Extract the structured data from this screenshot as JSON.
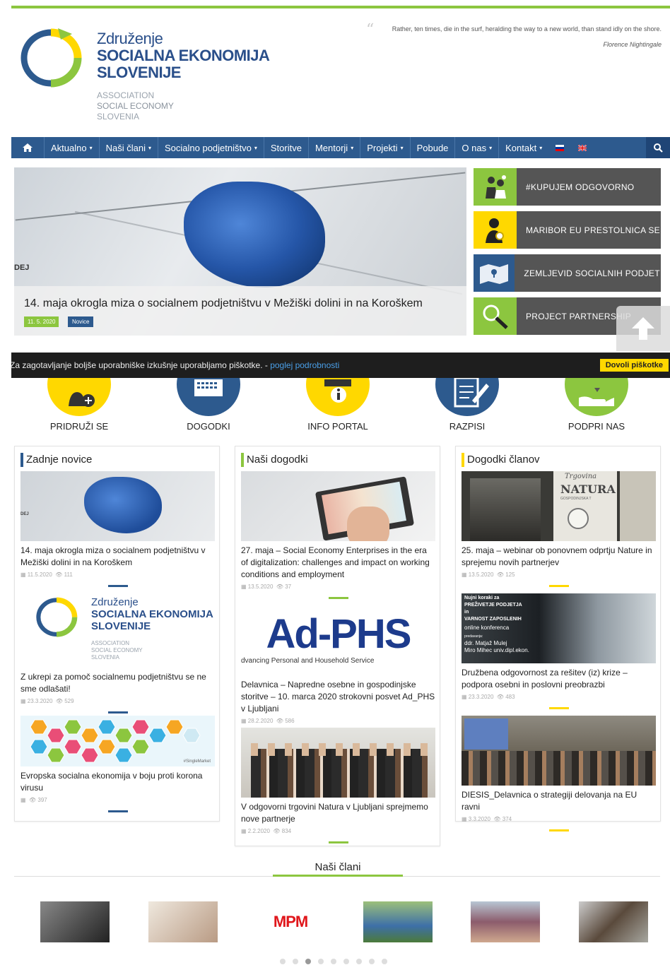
{
  "logo": {
    "line1": "Združenje",
    "line2": "SOCIALNA EKONOMIJA",
    "line3": "SLOVENIJE",
    "sub1": "ASSOCIATION",
    "sub2": "SOCIAL ECONOMY",
    "sub3": "SLOVENIA"
  },
  "quote": {
    "text": "Rather, ten times, die in the surf, heralding the way to a new world, than stand idly on the shore.",
    "author": "Florence Nightingale"
  },
  "nav": {
    "items": [
      {
        "label": "Aktualno",
        "dropdown": true
      },
      {
        "label": "Naši člani",
        "dropdown": true
      },
      {
        "label": "Socialno podjetništvo",
        "dropdown": true
      },
      {
        "label": "Storitve",
        "dropdown": false
      },
      {
        "label": "Mentorji",
        "dropdown": true
      },
      {
        "label": "Projekti",
        "dropdown": true
      },
      {
        "label": "Pobude",
        "dropdown": false
      },
      {
        "label": "O nas",
        "dropdown": true
      },
      {
        "label": "Kontakt",
        "dropdown": true
      }
    ]
  },
  "hero": {
    "image_text": "DEJ",
    "title": "14. maja okrogla miza o socialnem podjetništvu v Mežiški dolini in na Koroškem",
    "date": "11. 5. 2020",
    "category": "Novice"
  },
  "tiles": [
    {
      "label": "#KUPUJEM ODGOVORNO",
      "icon": "people-icon",
      "color": "#8cc63f"
    },
    {
      "label": "MARIBOR EU PRESTOLNICA SE",
      "icon": "award-person-icon",
      "color": "#ffd800"
    },
    {
      "label": "ZEMLJEVID SOCIALNIH PODJETIJ",
      "icon": "map-icon",
      "color": "#2d5a8e"
    },
    {
      "label": "PROJECT PARTNERSHIP",
      "icon": "search-icon",
      "color": "#8cc63f"
    }
  ],
  "cookie": {
    "text": "Za zagotavljanje boljše uporabniške izkušnje uporabljamo piškotke. - ",
    "link": "poglej podrobnosti",
    "button": "Dovoli piškotke"
  },
  "circles": [
    {
      "label": "PRIDRUŽI SE",
      "color": "#ffd800"
    },
    {
      "label": "DOGODKI",
      "color": "#2d5a8e"
    },
    {
      "label": "INFO PORTAL",
      "color": "#ffd800"
    },
    {
      "label": "RAZPISI",
      "color": "#2d5a8e"
    },
    {
      "label": "PODPRI NAS",
      "color": "#8cc63f"
    }
  ],
  "columns": [
    {
      "title": "Zadnje novice",
      "accent": "#2d5a8e",
      "cards": [
        {
          "title": "14. maja okrogla miza o socialnem podjetništvu v Mežiški dolini in na Koroškem",
          "date": "11.5.2020",
          "views": "111"
        },
        {
          "title": "Z ukrepi za pomoč socialnemu podjetništvu se ne sme odlašati!",
          "date": "23.3.2020",
          "views": "529"
        },
        {
          "title": "Evropska socialna ekonomija v boju proti korona virusu",
          "date": "",
          "views": "397"
        }
      ]
    },
    {
      "title": "Naši dogodki",
      "accent": "#8cc63f",
      "cards": [
        {
          "title": "27. maja – Social Economy Enterprises in the era of digitalization: challenges and impact on working conditions and employment",
          "date": "13.5.2020",
          "views": "37"
        },
        {
          "title": "Delavnica – Napredne osebne in gospodinjske storitve – 10. marca 2020 strokovni posvet Ad_PHS v Ljubljani",
          "date": "28.2.2020",
          "views": "586"
        },
        {
          "title": "V odgovorni trgovini Natura v Ljubljani sprejmemo nove partnerje",
          "date": "2.2.2020",
          "views": "834"
        }
      ]
    },
    {
      "title": "Dogodki članov",
      "accent": "#ffd800",
      "cards": [
        {
          "title": "25. maja – webinar ob ponovnem odprtju Nature in sprejemu novih partnerjev",
          "date": "13.5.2020",
          "views": "125"
        },
        {
          "title": "Družbena odgovornost za rešitev (iz) krize – podpora osebni in poslovni preobrazbi",
          "date": "23.3.2020",
          "views": "483"
        },
        {
          "title": "DIESIS_Delavnica o strategiji delovanja na EU ravni",
          "date": "3.3.2020",
          "views": "374"
        }
      ]
    }
  ],
  "image_texts": {
    "adphs": "Ad-PHS",
    "adphs_sub": "dvancing Personal and Household Service",
    "natura": "NATURA",
    "natura_script": "Trgovina",
    "natura_sub": "GOSPODINJSKA T",
    "webinar_lines": [
      "Nujni koraki za",
      "PREŽIVETJE PODJETJA",
      "in",
      "VARNOST ZAPOSLENIH",
      "online konferenca",
      "predavanja:",
      "ddr. Matjaž Mulej",
      "Miro Mihec univ.dipl.ekon."
    ],
    "singlemarket": "#SingleMarket",
    "mpm": "MPM"
  },
  "members": {
    "title": "Naši člani",
    "count_dots": 9,
    "active_dot": 2
  }
}
